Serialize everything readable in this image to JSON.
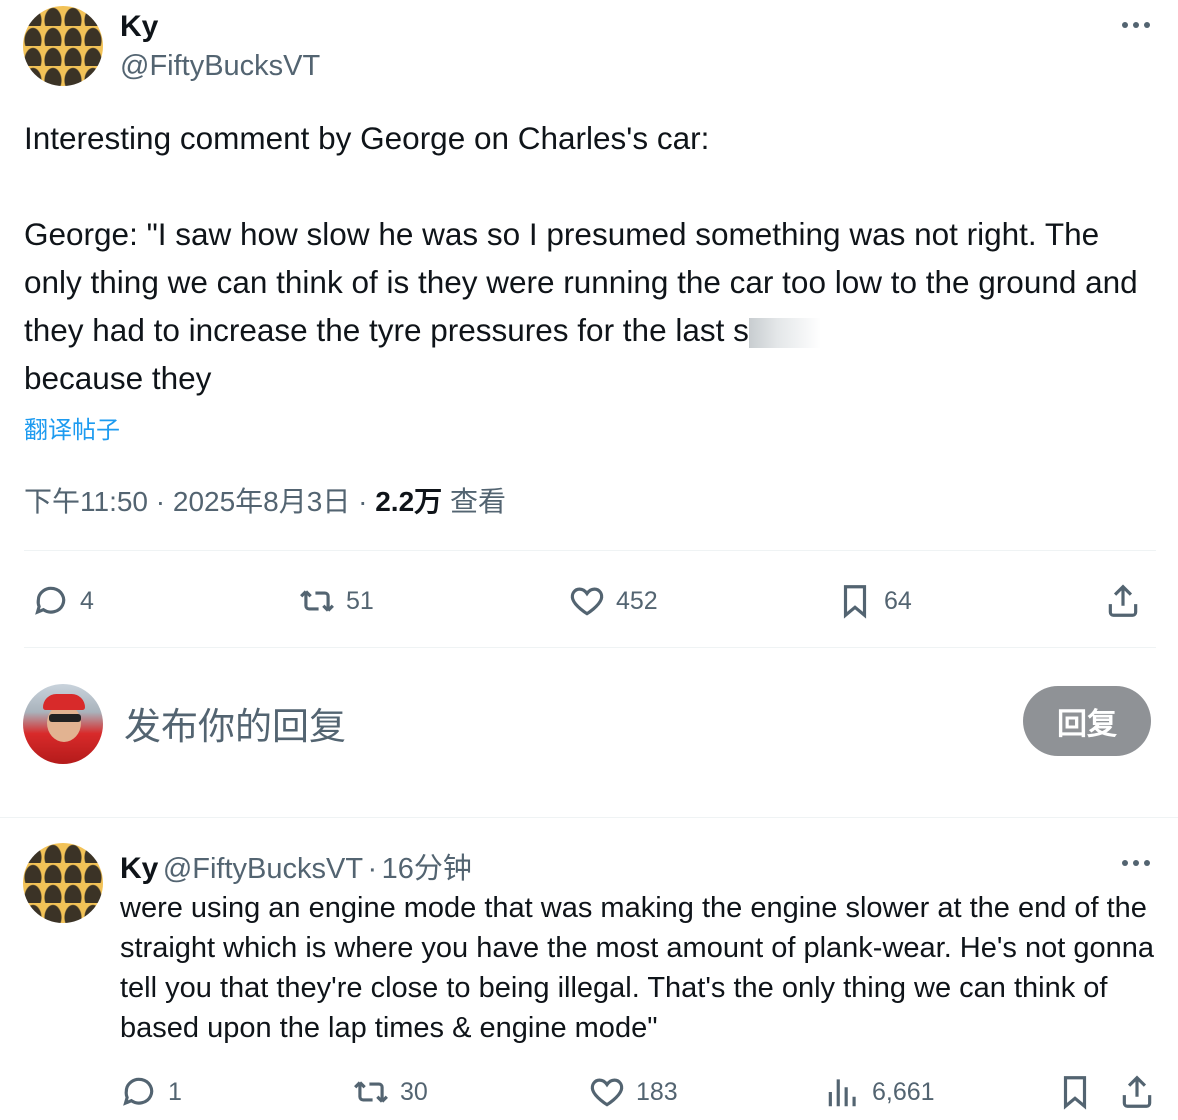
{
  "tweet": {
    "author_name": "Ky",
    "author_handle": "@FiftyBucksVT",
    "text_line1": "Interesting comment by George on Charles's car:",
    "text_quote": "George: \"I saw how slow he was so I presumed something was not right. The only thing we can think of is they were running the car too low to the ground and they had to increase the tyre pressures for the last s",
    "text_tail": "because they",
    "translate_label": "翻译帖子",
    "time": "下午11:50",
    "date": "2025年8月3日",
    "separator": "·",
    "views_count": "2.2万",
    "views_label": "查看",
    "replies": "4",
    "retweets": "51",
    "likes": "452",
    "bookmarks": "64"
  },
  "composer": {
    "placeholder": "发布你的回复",
    "button_label": "回复"
  },
  "reply": {
    "author_name": "Ky",
    "author_handle": "@FiftyBucksVT",
    "time": "16分钟",
    "separator": "·",
    "text": "were using an engine mode that was making the engine slower at the end of the straight which is where you have the most amount of plank-wear. He's not gonna tell you that they're close to being illegal. That's the only thing we can think of based upon the lap times & engine mode\"",
    "replies": "1",
    "retweets": "30",
    "likes": "183",
    "views": "6,661"
  },
  "icons": {
    "more": "more-dots-icon",
    "reply": "reply-icon",
    "retweet": "retweet-icon",
    "like": "heart-icon",
    "bookmark": "bookmark-icon",
    "share": "share-icon",
    "views": "views-icon"
  },
  "colors": {
    "link": "#1d9bf0",
    "secondary_text": "#536471",
    "reply_button": "#8f9296"
  }
}
